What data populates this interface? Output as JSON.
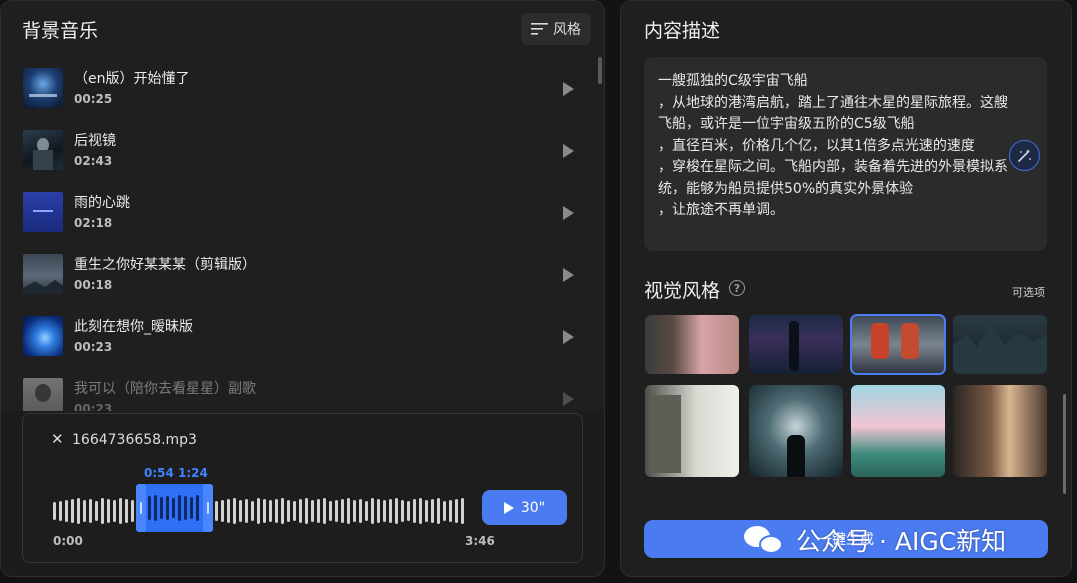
{
  "left_panel": {
    "title": "背景音乐",
    "style_button": "风格",
    "tracks": [
      {
        "name": "（en版）开始懂了",
        "duration": "00:25"
      },
      {
        "name": "后视镜",
        "duration": "02:43"
      },
      {
        "name": "雨的心跳",
        "duration": "02:18"
      },
      {
        "name": "重生之你好某某某（剪辑版）",
        "duration": "00:18"
      },
      {
        "name": "此刻在想你_暧昧版",
        "duration": "00:23"
      },
      {
        "name": "我可以（陪你去看星星）副歌",
        "duration": "00:23"
      }
    ],
    "player": {
      "file_name": "1664736658.mp3",
      "selection_start": "0:54",
      "selection_end": "1:24",
      "time_start": "0:00",
      "time_end": "3:46",
      "play_label": "30\"",
      "selection_start_fraction": 0.239,
      "selection_end_fraction": 0.372
    }
  },
  "right_panel": {
    "title": "内容描述",
    "description_lines": [
      "一艘孤独的C级宇宙飞船",
      "，从地球的港湾启航，踏上了通往木星的星际旅程。这艘",
      "飞船，或许是一位宇宙级五阶的C5级飞船",
      "，直径百米，价格几个亿，以其1倍多点光速的速度",
      "，穿梭在星际之间。飞船内部，装备着先进的外景模拟系",
      "统，能够为船员提供50%的真实外景体验",
      "，让旅途不再单调。"
    ],
    "visual_style_title": "视觉风格",
    "help_glyph": "?",
    "optional_label": "可选项",
    "generate_button": "一键生成"
  },
  "watermark": {
    "text": "公众号 · AIGC新知"
  },
  "colors": {
    "accent": "#4b7bf0",
    "selection": "#2f6ff5",
    "panel_bg": "#1f1f1f",
    "page_bg": "#131313"
  },
  "icons": [
    "list-style-icon",
    "play-icon",
    "close-icon",
    "magic-wand-icon",
    "help-icon",
    "wechat-icon"
  ]
}
